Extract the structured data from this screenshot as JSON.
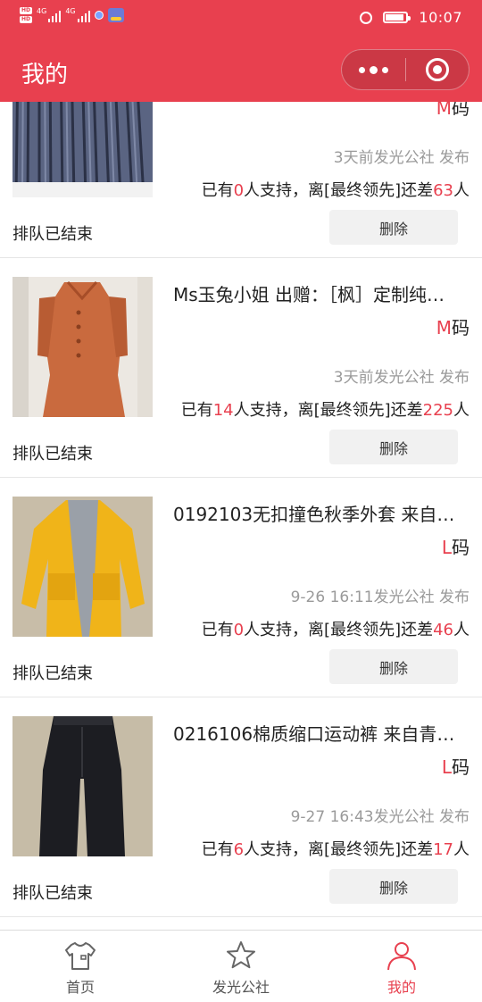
{
  "status_bar": {
    "hd1": "HD",
    "hd2": "HD",
    "net1": "4G",
    "net2": "4G",
    "time": "10:07"
  },
  "header": {
    "title": "我的"
  },
  "items": [
    {
      "name": "",
      "size_letter": "M",
      "size_suffix": "码",
      "meta": "3天前发光公社 发布",
      "support_prefix": "已有",
      "supporters": "0",
      "support_middle": "人支持，离[最终领先]还差",
      "remaining": "63",
      "support_suffix": "人",
      "status": "排队已结束",
      "delete_label": "删除"
    },
    {
      "name": "Ms玉兔小姐 出赠：［枫］定制纯…",
      "size_letter": "M",
      "size_suffix": "码",
      "meta": "3天前发光公社 发布",
      "support_prefix": "已有",
      "supporters": "14",
      "support_middle": "人支持，离[最终领先]还差",
      "remaining": "225",
      "support_suffix": "人",
      "status": "排队已结束",
      "delete_label": "删除"
    },
    {
      "name": "0192103无扣撞色秋季外套 来自…",
      "size_letter": "L",
      "size_suffix": "码",
      "meta": "9-26 16:11发光公社 发布",
      "support_prefix": "已有",
      "supporters": "0",
      "support_middle": "人支持，离[最终领先]还差",
      "remaining": "46",
      "support_suffix": "人",
      "status": "排队已结束",
      "delete_label": "删除"
    },
    {
      "name": "0216106棉质缩口运动裤 来自青…",
      "size_letter": "L",
      "size_suffix": "码",
      "meta": "9-27 16:43发光公社 发布",
      "support_prefix": "已有",
      "supporters": "6",
      "support_middle": "人支持，离[最终领先]还差",
      "remaining": "17",
      "support_suffix": "人",
      "status": "排队已结束",
      "delete_label": "删除"
    }
  ],
  "tabbar": {
    "home": "首页",
    "community": "发光公社",
    "mine": "我的"
  },
  "colors": {
    "brand": "#e8404f",
    "muted": "#9a9a9a"
  },
  "icons": {
    "home": "shirt-icon",
    "community": "star-icon",
    "mine": "person-icon"
  }
}
